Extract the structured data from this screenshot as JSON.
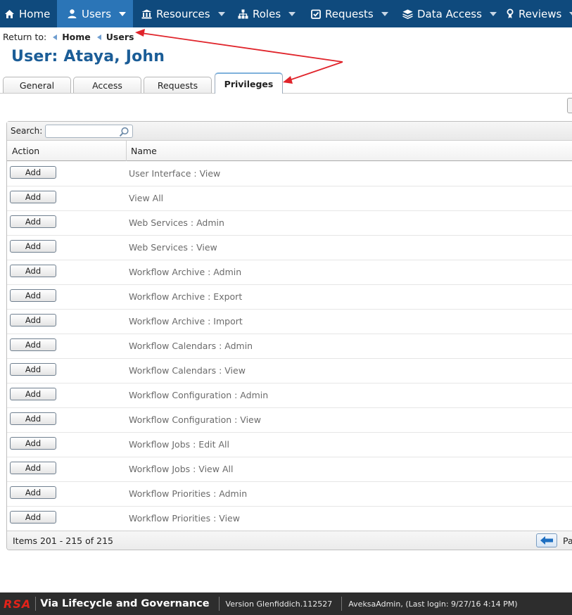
{
  "nav": {
    "items": [
      {
        "label": "Home",
        "icon": "home-icon"
      },
      {
        "label": "Users",
        "icon": "user-icon"
      },
      {
        "label": "Resources",
        "icon": "building-icon"
      },
      {
        "label": "Roles",
        "icon": "hierarchy-icon"
      },
      {
        "label": "Requests",
        "icon": "checkbox-icon"
      },
      {
        "label": "Data Access",
        "icon": "stack-icon"
      },
      {
        "label": "Reviews",
        "icon": "ribbon-icon"
      }
    ],
    "active": "Users"
  },
  "breadcrumb": {
    "prefix": "Return to:",
    "items": [
      "Home",
      "Users"
    ]
  },
  "page": {
    "title": "User: Ataya, John"
  },
  "tabs": {
    "items": [
      "General",
      "Access",
      "Requests",
      "Privileges"
    ],
    "active": "Privileges"
  },
  "grid": {
    "search_label": "Search:",
    "search_value": "",
    "columns": [
      "Action",
      "Name"
    ],
    "action_label": "Add",
    "rows": [
      "User Interface : View",
      "View All",
      "Web Services : Admin",
      "Web Services : View",
      "Workflow Archive : Admin",
      "Workflow Archive : Export",
      "Workflow Archive : Import",
      "Workflow Calendars : Admin",
      "Workflow Calendars : View",
      "Workflow Configuration : Admin",
      "Workflow Configuration : View",
      "Workflow Jobs : Edit All",
      "Workflow Jobs : View All",
      "Workflow Priorities : Admin",
      "Workflow Priorities : View"
    ],
    "items_status": "Items 201 - 215 of 215",
    "page_label_partial": "Pa"
  },
  "footer": {
    "brand": "RSA",
    "product": "Via Lifecycle and Governance",
    "version": "Version Glenfiddich.112527",
    "login": "AveksaAdmin,  (Last login: 9/27/16 4:14 PM)"
  },
  "colors": {
    "nav_bg": "#0f4a7d",
    "nav_active": "#2b75b7",
    "title": "#1b5d97",
    "annotation_arrow": "#e0242b",
    "brand_red": "#e2231a"
  }
}
